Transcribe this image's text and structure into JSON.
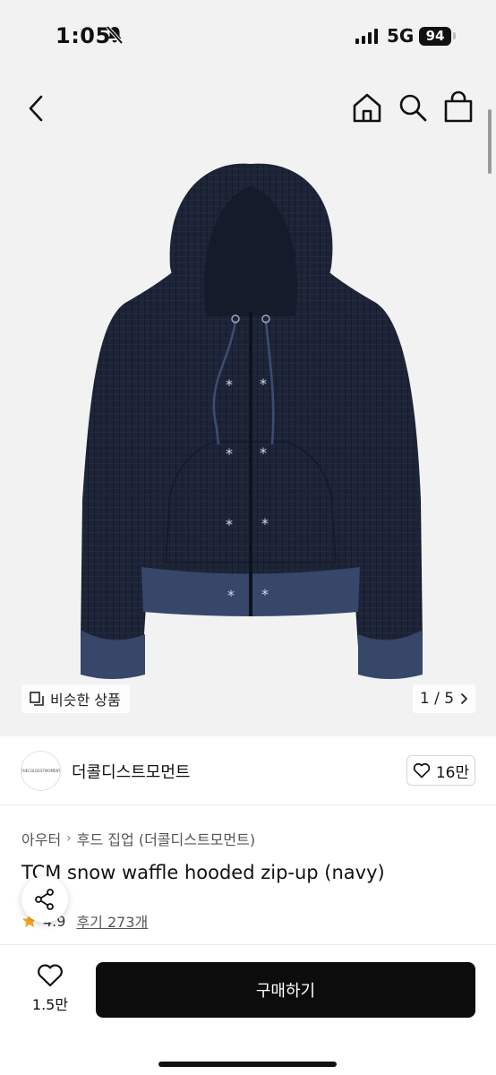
{
  "status": {
    "time": "1:05",
    "network": "5G",
    "battery": "94"
  },
  "hero": {
    "similar_label": "비슷한 상품",
    "page_indicator": "1 / 5"
  },
  "shop": {
    "name": "더콜디스트모먼트",
    "logo_text": "THECOLDESTMOMENT",
    "like_count": "16만"
  },
  "breadcrumb": [
    "아우터",
    "후드 집업 (더콜디스트모먼트)"
  ],
  "product": {
    "title": "TCM snow waffle hooded zip-up (navy)",
    "rating": "4.9",
    "review_label": "후기 273개"
  },
  "bottom": {
    "wish_count": "1.5만",
    "buy_label": "구매하기"
  },
  "colors": {
    "accent": "#0c0c0c",
    "star": "#f5a623",
    "hoodie": "#1d2437"
  },
  "icons": [
    "bell-off-icon",
    "back-icon",
    "home-icon",
    "search-icon",
    "shopping-bag-icon",
    "copy-icon",
    "chevron-right-icon",
    "heart-icon",
    "star-icon",
    "share-icon"
  ]
}
